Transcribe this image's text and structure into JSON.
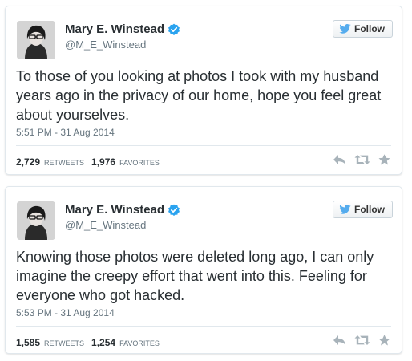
{
  "tweets": [
    {
      "user": {
        "name": "Mary E. Winstead",
        "handle": "@M_E_Winstead"
      },
      "follow_label": "Follow",
      "text": "To those of you looking at photos I took with my husband years ago in the privacy of our home, hope you feel great about yourselves.",
      "timestamp": "5:51 PM - 31 Aug 2014",
      "retweets": {
        "count": "2,729",
        "label": "RETWEETS"
      },
      "favorites": {
        "count": "1,976",
        "label": "FAVORITES"
      }
    },
    {
      "user": {
        "name": "Mary E. Winstead",
        "handle": "@M_E_Winstead"
      },
      "follow_label": "Follow",
      "text": "Knowing those photos were deleted long ago, I can only imagine the creepy effort that went into this. Feeling for everyone who got hacked.",
      "timestamp": "5:53 PM - 31 Aug 2014",
      "retweets": {
        "count": "1,585",
        "label": "RETWEETS"
      },
      "favorites": {
        "count": "1,254",
        "label": "FAVORITES"
      }
    }
  ],
  "icons": {
    "verified": "verified-badge-icon",
    "follow": "twitter-bird-icon",
    "reply": "reply-icon",
    "retweet": "retweet-icon",
    "favorite": "star-icon"
  },
  "colors": {
    "verified_blue": "#2aa3ef",
    "twitter_blue": "#55acee",
    "action_gray": "#a8b3ba",
    "text": "#292f33",
    "muted": "#66757f"
  }
}
